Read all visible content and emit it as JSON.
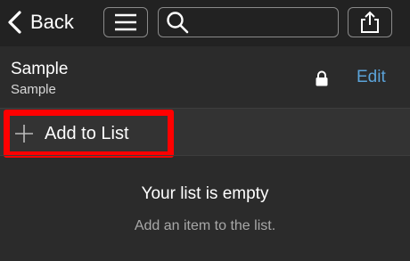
{
  "topbar": {
    "back_label": "Back",
    "search_placeholder": ""
  },
  "list": {
    "title": "Sample",
    "subtitle": "Sample",
    "edit_label": "Edit"
  },
  "add_row": {
    "label": "Add to List"
  },
  "empty_state": {
    "title": "Your list is empty",
    "message": "Add an item to the list."
  },
  "colors": {
    "background": "#2b2b2b",
    "topbar": "#222222",
    "accent_link": "#5ba3d9",
    "highlight": "#ff0000"
  },
  "icons": [
    "chevron-left-icon",
    "hamburger-menu-icon",
    "search-icon",
    "share-icon",
    "lock-icon",
    "plus-icon"
  ]
}
